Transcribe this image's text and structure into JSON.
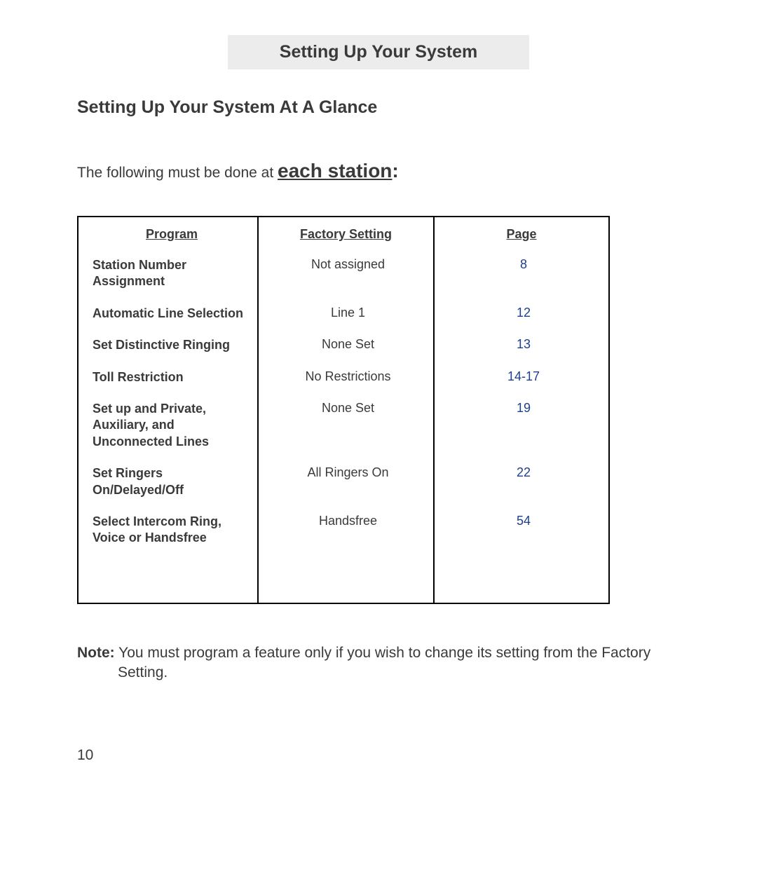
{
  "banner_title": "Setting Up Your System",
  "section_heading": "Setting Up Your System At A Glance",
  "intro_prefix": "The following must be done at ",
  "intro_emph": "each station",
  "intro_colon": ":",
  "table": {
    "headers": {
      "program": "Program",
      "factory": "Factory Setting",
      "page": "Page"
    },
    "rows": [
      {
        "program": "Station Number Assignment",
        "factory": "Not assigned",
        "page": "8"
      },
      {
        "program": "Automatic Line Selection",
        "factory": "Line 1",
        "page": "12"
      },
      {
        "program": "Set Distinctive Ringing",
        "factory": "None Set",
        "page": "13"
      },
      {
        "program": "Toll Restriction",
        "factory": "No Restrictions",
        "page": "14-17"
      },
      {
        "program": "Set up and Private, Auxiliary, and Unconnected Lines",
        "factory": "None Set",
        "page": "19"
      },
      {
        "program": "Set Ringers On/Delayed/Off",
        "factory": "All Ringers On",
        "page": "22"
      },
      {
        "program": "Select Intercom Ring, Voice or Handsfree",
        "factory": "Handsfree",
        "page": "54"
      }
    ]
  },
  "note_label": "Note:",
  "note_text": " You must program a feature only if you wish to change its setting from the Factory Setting.",
  "page_number": "10"
}
